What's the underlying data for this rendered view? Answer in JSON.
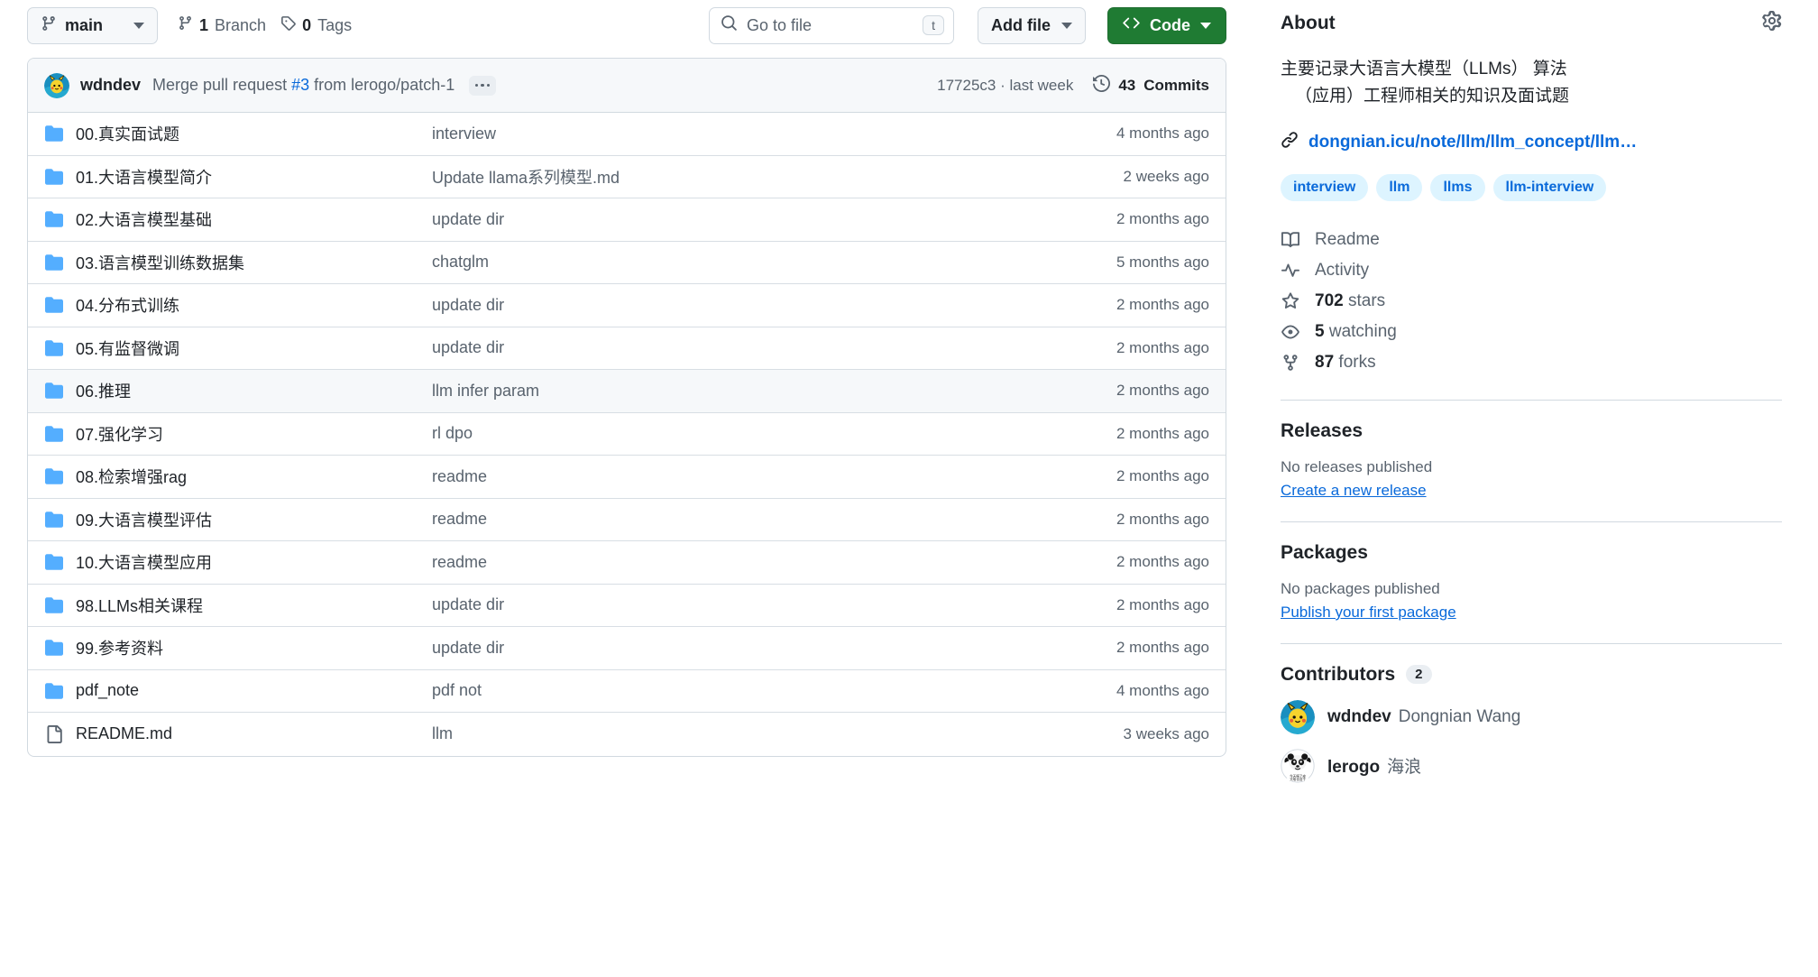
{
  "toolbar": {
    "branch_name": "main",
    "branch_icon": "git-branch-icon",
    "branches_count": "1",
    "branches_label": "Branch",
    "tags_count": "0",
    "tags_label": "Tags",
    "search_placeholder": "Go to file",
    "search_shortcut": "t",
    "add_file_label": "Add file",
    "code_label": "Code",
    "code_button_color": "#1f7b33"
  },
  "commit_header": {
    "author": "wdndev",
    "message_prefix": "Merge pull request ",
    "message_pr": "#3",
    "message_suffix": " from lerogo/patch-1",
    "hash_and_time": "17725c3 · last week",
    "commits_count": "43",
    "commits_label": "Commits"
  },
  "files": [
    {
      "type": "folder",
      "name": "00.真实面试题",
      "message": "interview",
      "time": "4 months ago",
      "highlight": false
    },
    {
      "type": "folder",
      "name": "01.大语言模型简介",
      "message": "Update llama系列模型.md",
      "time": "2 weeks ago",
      "highlight": false
    },
    {
      "type": "folder",
      "name": "02.大语言模型基础",
      "message": "update dir",
      "time": "2 months ago",
      "highlight": false
    },
    {
      "type": "folder",
      "name": "03.语言模型训练数据集",
      "message": "chatglm",
      "time": "5 months ago",
      "highlight": false
    },
    {
      "type": "folder",
      "name": "04.分布式训练",
      "message": "update dir",
      "time": "2 months ago",
      "highlight": false
    },
    {
      "type": "folder",
      "name": "05.有监督微调",
      "message": "update dir",
      "time": "2 months ago",
      "highlight": false
    },
    {
      "type": "folder",
      "name": "06.推理",
      "message": "llm infer param",
      "time": "2 months ago",
      "highlight": true
    },
    {
      "type": "folder",
      "name": "07.强化学习",
      "message": "rl dpo",
      "time": "2 months ago",
      "highlight": false
    },
    {
      "type": "folder",
      "name": "08.检索增强rag",
      "message": "readme",
      "time": "2 months ago",
      "highlight": false
    },
    {
      "type": "folder",
      "name": "09.大语言模型评估",
      "message": "readme",
      "time": "2 months ago",
      "highlight": false
    },
    {
      "type": "folder",
      "name": "10.大语言模型应用",
      "message": "readme",
      "time": "2 months ago",
      "highlight": false
    },
    {
      "type": "folder",
      "name": "98.LLMs相关课程",
      "message": "update dir",
      "time": "2 months ago",
      "highlight": false
    },
    {
      "type": "folder",
      "name": "99.参考资料",
      "message": "update dir",
      "time": "2 months ago",
      "highlight": false
    },
    {
      "type": "folder",
      "name": "pdf_note",
      "message": "pdf not",
      "time": "4 months ago",
      "highlight": false
    },
    {
      "type": "file",
      "name": "README.md",
      "message": "llm",
      "time": "3 weeks ago",
      "highlight": false
    }
  ],
  "about": {
    "title": "About",
    "settings_icon": "gear-icon",
    "description_line1": "主要记录大语言大模型（LLMs） 算法",
    "description_line2": "（应用）工程师相关的知识及面试题",
    "homepage": "dongnian.icu/note/llm/llm_concept/llm…",
    "topics": [
      "interview",
      "llm",
      "llms",
      "llm-interview"
    ],
    "topic_color": "#0969da",
    "topic_bg": "#ddf4ff",
    "stats": [
      {
        "icon": "book-icon",
        "text": "Readme",
        "count": ""
      },
      {
        "icon": "pulse-icon",
        "text": "Activity",
        "count": ""
      },
      {
        "icon": "star-icon",
        "text": "stars",
        "count": "702"
      },
      {
        "icon": "eye-icon",
        "text": "watching",
        "count": "5"
      },
      {
        "icon": "fork-icon",
        "text": "forks",
        "count": "87"
      }
    ]
  },
  "releases": {
    "title": "Releases",
    "empty_text": "No releases published",
    "action_label": "Create a new release"
  },
  "packages": {
    "title": "Packages",
    "empty_text": "No packages published",
    "action_label": "Publish your first package"
  },
  "contributors": {
    "title": "Contributors",
    "count": "2",
    "people": [
      {
        "username": "wdndev",
        "fullname": "Dongnian Wang",
        "avatar": "pikachu-avatar"
      },
      {
        "username": "lerogo",
        "fullname": "海浪",
        "avatar": "panda-avatar"
      }
    ]
  }
}
